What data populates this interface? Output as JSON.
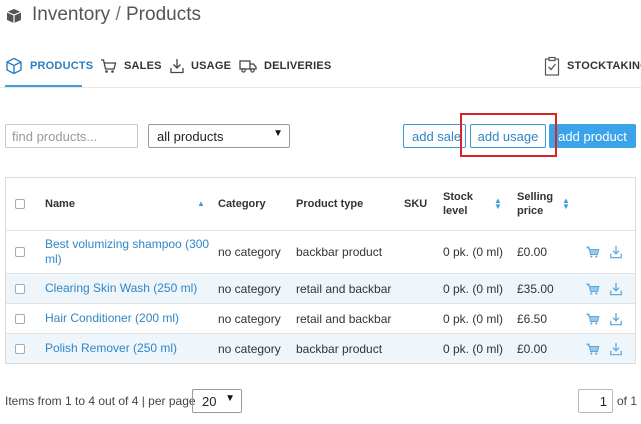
{
  "header": {
    "title_section": "Inventory",
    "separator": "/",
    "title_page": "Products",
    "icon": "box-icon"
  },
  "tabs": [
    {
      "label": "PRODUCTS",
      "icon": "cube-icon",
      "active": true
    },
    {
      "label": "SALES",
      "icon": "cart-icon",
      "active": false
    },
    {
      "label": "USAGE",
      "icon": "download-icon",
      "active": false
    },
    {
      "label": "DELIVERIES",
      "icon": "truck-icon",
      "active": false
    },
    {
      "label": "STOCKTAKING",
      "icon": "clipboard-icon",
      "active": false
    }
  ],
  "toolbar": {
    "search_placeholder": "find products...",
    "filter_value": "all products",
    "add_sale_label": "add sale",
    "add_usage_label": "add usage",
    "add_product_label": "add product"
  },
  "table": {
    "headers": {
      "name": "Name",
      "category": "Category",
      "product_type": "Product type",
      "sku": "SKU",
      "stock_line1": "Stock",
      "stock_line2": "level",
      "price_line1": "Selling",
      "price_line2": "price"
    },
    "rows": [
      {
        "name": "Best volumizing shampoo (300 ml)",
        "category": "no category",
        "type": "backbar product",
        "sku": "",
        "stock": "0 pk. (0 ml)",
        "price": "£0.00"
      },
      {
        "name": "Clearing Skin Wash (250 ml)",
        "category": "no category",
        "type": "retail and backbar",
        "sku": "",
        "stock": "0 pk. (0 ml)",
        "price": "£35.00"
      },
      {
        "name": "Hair Conditioner (200 ml)",
        "category": "no category",
        "type": "retail and backbar",
        "sku": "",
        "stock": "0 pk. (0 ml)",
        "price": "£6.50"
      },
      {
        "name": "Polish Remover (250 ml)",
        "category": "no category",
        "type": "backbar product",
        "sku": "",
        "stock": "0 pk. (0 ml)",
        "price": "£0.00"
      }
    ]
  },
  "footer": {
    "items_text": "Items from 1 to 4 out of 4 | per page",
    "per_page_value": "20",
    "page_value": "1",
    "of_text": "of 1"
  },
  "colors": {
    "accent": "#2f86c6",
    "primary_button": "#3ba3ea",
    "highlight": "#d9242b",
    "alt_row": "#eef5fb"
  }
}
